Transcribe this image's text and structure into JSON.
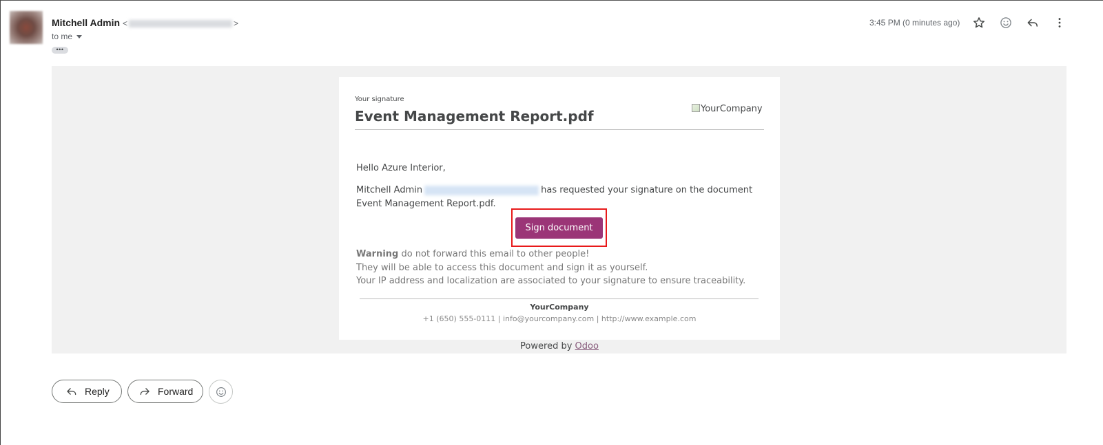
{
  "header": {
    "sender_name": "Mitchell Admin",
    "recipient_label": "to me",
    "timestamp": "3:45 PM (0 minutes ago)",
    "more_details": "•••",
    "icons": [
      "star-icon",
      "emoji-icon",
      "reply-icon",
      "more-vert-icon"
    ]
  },
  "email": {
    "subtitle": "Your signature",
    "document_title": "Event Management Report.pdf",
    "logo_alt": "YourCompany",
    "greeting": "Hello Azure Interior,",
    "request_name": "Mitchell Admin",
    "request_text": "has requested your signature on the document Event Management Report.pdf.",
    "sign_button": "Sign document",
    "warning_label": "Warning",
    "warning_line1": "do not forward this email to other people!",
    "warning_line2": "They will be able to access this document and sign it as yourself.",
    "warning_line3": "Your IP address and localization are associated to your signature to ensure traceability.",
    "footer_company": "YourCompany",
    "footer_contact": "+1 (650) 555-0111 | info@yourcompany.com | http://www.example.com",
    "powered_by": "Powered by",
    "powered_link": "Odoo",
    "button_color": "#9b3577",
    "highlight_color": "#e8191a"
  },
  "actions": {
    "reply": "Reply",
    "forward": "Forward"
  }
}
